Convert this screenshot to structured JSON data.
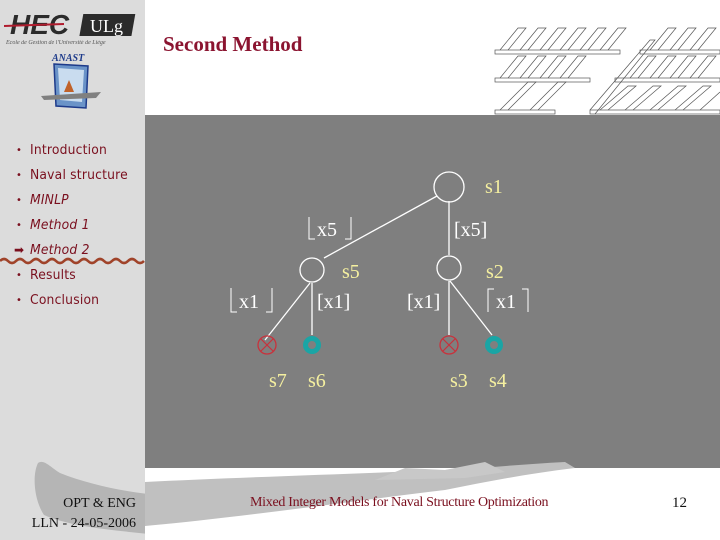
{
  "header": {
    "title": "Second Method",
    "logo_text": "HEC ULg",
    "logo_subtitle": "Ecole de Gestion de l'Université de Liège",
    "anast_label": "ANAST"
  },
  "sidebar": {
    "items": [
      {
        "label": "Introduction",
        "bullet": "•",
        "active": false
      },
      {
        "label": "Naval structure",
        "bullet": "•",
        "active": false
      },
      {
        "label": "MINLP",
        "bullet": "•",
        "active": false
      },
      {
        "label": "Method 1",
        "bullet": "•",
        "active": false
      },
      {
        "label": "Method 2",
        "bullet": "➡",
        "active": true
      },
      {
        "label": "Results",
        "bullet": "•",
        "active": false
      },
      {
        "label": "Conclusion",
        "bullet": "•",
        "active": false
      }
    ],
    "footer_line1": "OPT & ENG",
    "footer_line2": "LLN - 24-05-2006"
  },
  "diagram": {
    "nodes": {
      "s1": "s1",
      "s5": "s5",
      "s2": "s2",
      "s7": "s7",
      "s6": "s6",
      "s3": "s3",
      "s4": "s4"
    },
    "edges": {
      "s1_s5": "⌊x5⌋",
      "s1_s2": "⌈x5⌉",
      "s5_s7": "⌊x1⌋",
      "s5_s6": "⌈x1⌉",
      "s2_s3": "⌊x1⌋",
      "s2_s4": "⌈x1⌉"
    },
    "edge_text": {
      "s1_s5": "x5",
      "s1_s2": "[x5]",
      "s5_s7": "x1",
      "s5_s6": "[x1]",
      "s2_s3": "[x1]",
      "s2_s4": "x1"
    },
    "leaf_status": {
      "s7": "infeasible",
      "s6": "feasible",
      "s3": "infeasible",
      "s4": "feasible"
    },
    "colors": {
      "background": "#7f7f7f",
      "line": "#ffffff",
      "node_label": "#f5f0a0",
      "infeasible": "#c8323c",
      "feasible": "#1aa5a5"
    }
  },
  "footer": {
    "center_text": "Mixed Integer Models for Naval Structure Optimization",
    "page_number": "12"
  }
}
